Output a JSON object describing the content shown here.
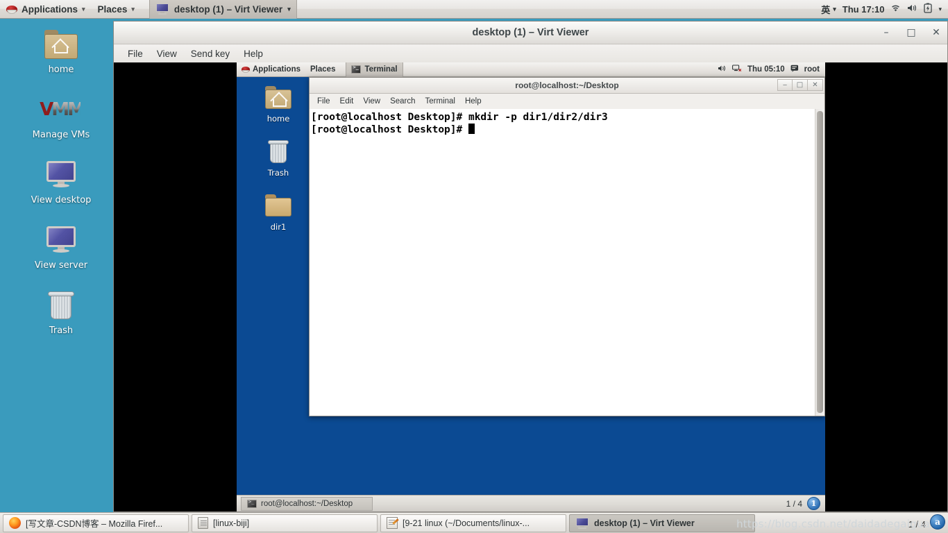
{
  "host": {
    "topbar": {
      "applications_label": "Applications",
      "places_label": "Places",
      "active_task_label": "desktop (1) – Virt Viewer",
      "input_method": "英",
      "clock": "Thu 17:10",
      "caret": "▾"
    },
    "desktop_icons": [
      {
        "label": "home",
        "icon": "folder-home-icon"
      },
      {
        "label": "Manage VMs",
        "icon": "vmm-logo-icon"
      },
      {
        "label": "View desktop",
        "icon": "monitor-icon"
      },
      {
        "label": "View server",
        "icon": "monitor-icon"
      },
      {
        "label": "Trash",
        "icon": "trash-icon"
      }
    ],
    "taskbar": {
      "items": [
        {
          "label": "[写文章-CSDN博客 – Mozilla Firef...",
          "icon": "firefox-icon",
          "active": false
        },
        {
          "label": "[linux-biji]",
          "icon": "document-icon",
          "active": false
        },
        {
          "label": "[9-21 linux (~/Documents/linux-...",
          "icon": "notepad-icon",
          "active": false
        },
        {
          "label": "desktop (1) – Virt Viewer",
          "icon": "monitor-icon",
          "active": true
        }
      ],
      "watermark": "https://blog.csdn.net/daidadegaigua",
      "page_count": "1 / 4",
      "badge": "a"
    }
  },
  "virt_viewer": {
    "title": "desktop (1) – Virt Viewer",
    "window_buttons": {
      "minimize": "–",
      "maximize": "□",
      "close": "✕"
    },
    "menu": [
      "File",
      "View",
      "Send key",
      "Help"
    ]
  },
  "guest": {
    "topbar": {
      "applications_label": "Applications",
      "places_label": "Places",
      "active_task_label": "Terminal",
      "clock": "Thu 05:10",
      "user": "root"
    },
    "desktop_icons": [
      {
        "label": "home",
        "icon": "folder-home-icon"
      },
      {
        "label": "Trash",
        "icon": "trash-icon"
      },
      {
        "label": "dir1",
        "icon": "folder-icon"
      }
    ],
    "taskbar": {
      "item_label": "root@localhost:~/Desktop",
      "workspace_indicator": "1 / 4",
      "workspace_badge": "1"
    }
  },
  "terminal": {
    "title": "root@localhost:~/Desktop",
    "window_buttons": {
      "minimize": "‒",
      "maximize": "□",
      "close": "✕"
    },
    "menu": [
      "File",
      "Edit",
      "View",
      "Search",
      "Terminal",
      "Help"
    ],
    "lines": [
      "[root@localhost Desktop]# mkdir -p dir1/dir2/dir3",
      "[root@localhost Desktop]# "
    ]
  },
  "colors": {
    "host_desktop": "#3a9bbd",
    "guest_desktop": "#0b4a93",
    "terminal_bg": "#ffffff",
    "terminal_fg": "#000000",
    "letterbox": "#000000"
  }
}
